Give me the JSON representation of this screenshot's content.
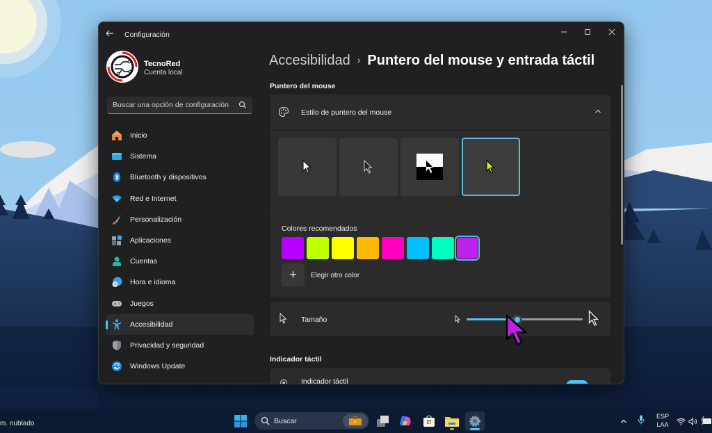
{
  "window": {
    "app_title": "Configuración",
    "controls": {
      "minimize": "—",
      "maximize": "☐",
      "close": "✕"
    }
  },
  "profile": {
    "name": "TecnoRed",
    "account_type": "Cuenta local"
  },
  "search": {
    "placeholder": "Buscar una opción de configuración"
  },
  "sidebar": {
    "items": [
      {
        "label": "Inicio",
        "icon": "home-icon",
        "active": false
      },
      {
        "label": "Sistema",
        "icon": "system-icon",
        "active": false
      },
      {
        "label": "Bluetooth y dispositivos",
        "icon": "bluetooth-icon",
        "active": false
      },
      {
        "label": "Red e Internet",
        "icon": "wifi-icon",
        "active": false
      },
      {
        "label": "Personalización",
        "icon": "brush-icon",
        "active": false
      },
      {
        "label": "Aplicaciones",
        "icon": "apps-icon",
        "active": false
      },
      {
        "label": "Cuentas",
        "icon": "accounts-icon",
        "active": false
      },
      {
        "label": "Hora e idioma",
        "icon": "time-language-icon",
        "active": false
      },
      {
        "label": "Juegos",
        "icon": "gamepad-icon",
        "active": false
      },
      {
        "label": "Accesibilidad",
        "icon": "accessibility-icon",
        "active": true
      },
      {
        "label": "Privacidad y seguridad",
        "icon": "shield-icon",
        "active": false
      },
      {
        "label": "Windows Update",
        "icon": "update-icon",
        "active": false
      }
    ]
  },
  "breadcrumb": {
    "parent": "Accesibilidad",
    "separator": "›",
    "current": "Puntero del mouse y entrada táctil"
  },
  "mouse_pointer": {
    "section_title": "Puntero del mouse",
    "style_card": {
      "title": "Estilo de puntero del mouse",
      "expanded": true,
      "styles": [
        {
          "name": "Blanco",
          "selected": false
        },
        {
          "name": "Negro",
          "selected": false
        },
        {
          "name": "Invertido",
          "selected": false
        },
        {
          "name": "Personalizado",
          "selected": true
        }
      ],
      "custom_pointer_color": "#c0ff00",
      "recommended_colors_label": "Colores recomendados",
      "recommended_colors": [
        "#b800ff",
        "#bfff00",
        "#ffff00",
        "#ffb900",
        "#ff00bf",
        "#00bfff",
        "#00ffbf",
        "#c022ee"
      ],
      "selected_color_index": 7,
      "choose_other_label": "Elegir otro color",
      "add_symbol": "+"
    },
    "size": {
      "label": "Tamaño",
      "value_fraction": 0.44
    }
  },
  "touch_indicator": {
    "section_title": "Indicador táctil",
    "row_label": "Indicador táctil",
    "enabled": true
  },
  "overlay_cursor_color": "#c21ee6",
  "accent_color": "#4cc2ff",
  "taskbar": {
    "weather_text": "m. nublado",
    "search_label": "Buscar",
    "language_line1": "ESP",
    "language_line2": "LAA"
  }
}
